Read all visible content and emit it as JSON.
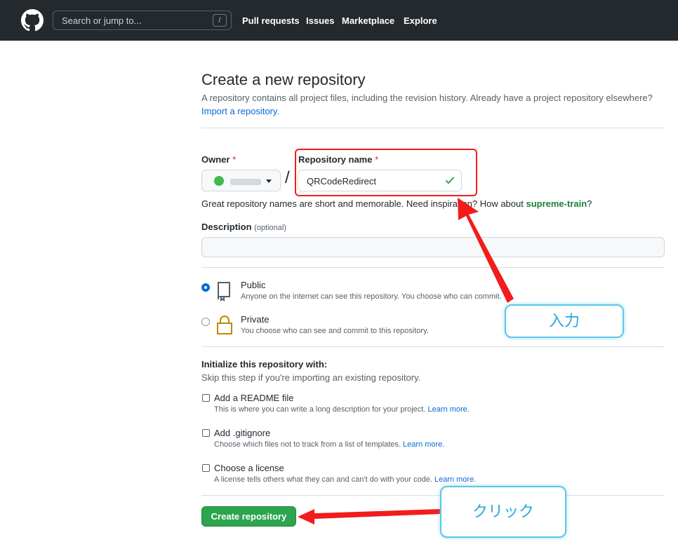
{
  "header": {
    "search_placeholder": "Search or jump to...",
    "search_shortcut": "/",
    "nav": [
      "Pull requests",
      "Issues",
      "Marketplace",
      "Explore"
    ]
  },
  "page": {
    "title": "Create a new repository",
    "subtitle": "A repository contains all project files, including the revision history. Already have a project repository elsewhere?",
    "import_link": "Import a repository."
  },
  "form": {
    "owner_label": "Owner",
    "required_mark": "*",
    "repo_label": "Repository name",
    "repo_value": "QRCodeRedirect",
    "separator": "/",
    "hint_prefix": "Great repository names are short and memorable. Need inspiration? How about ",
    "hint_suggestion": "supreme-train",
    "hint_suffix": "?",
    "description_label": "Description",
    "description_optional": "(optional)"
  },
  "visibility": {
    "public_title": "Public",
    "public_desc": "Anyone on the internet can see this repository. You choose who can commit.",
    "private_title": "Private",
    "private_desc": "You choose who can see and commit to this repository."
  },
  "init": {
    "title": "Initialize this repository with:",
    "subtitle": "Skip this step if you're importing an existing repository.",
    "readme_title": "Add a README file",
    "readme_desc": "This is where you can write a long description for your project.",
    "gitignore_title": "Add .gitignore",
    "gitignore_desc": "Choose which files not to track from a list of templates.",
    "license_title": "Choose a license",
    "license_desc": "A license tells others what they can and can't do with your code.",
    "learn_more": "Learn more."
  },
  "create_button": "Create repository",
  "annotations": {
    "input_callout": "入力",
    "click_callout": "クリック",
    "color": "#f21c1c"
  },
  "colors": {
    "header_bg": "#24292e",
    "primary_button": "#2da44e",
    "link": "#0969da"
  }
}
